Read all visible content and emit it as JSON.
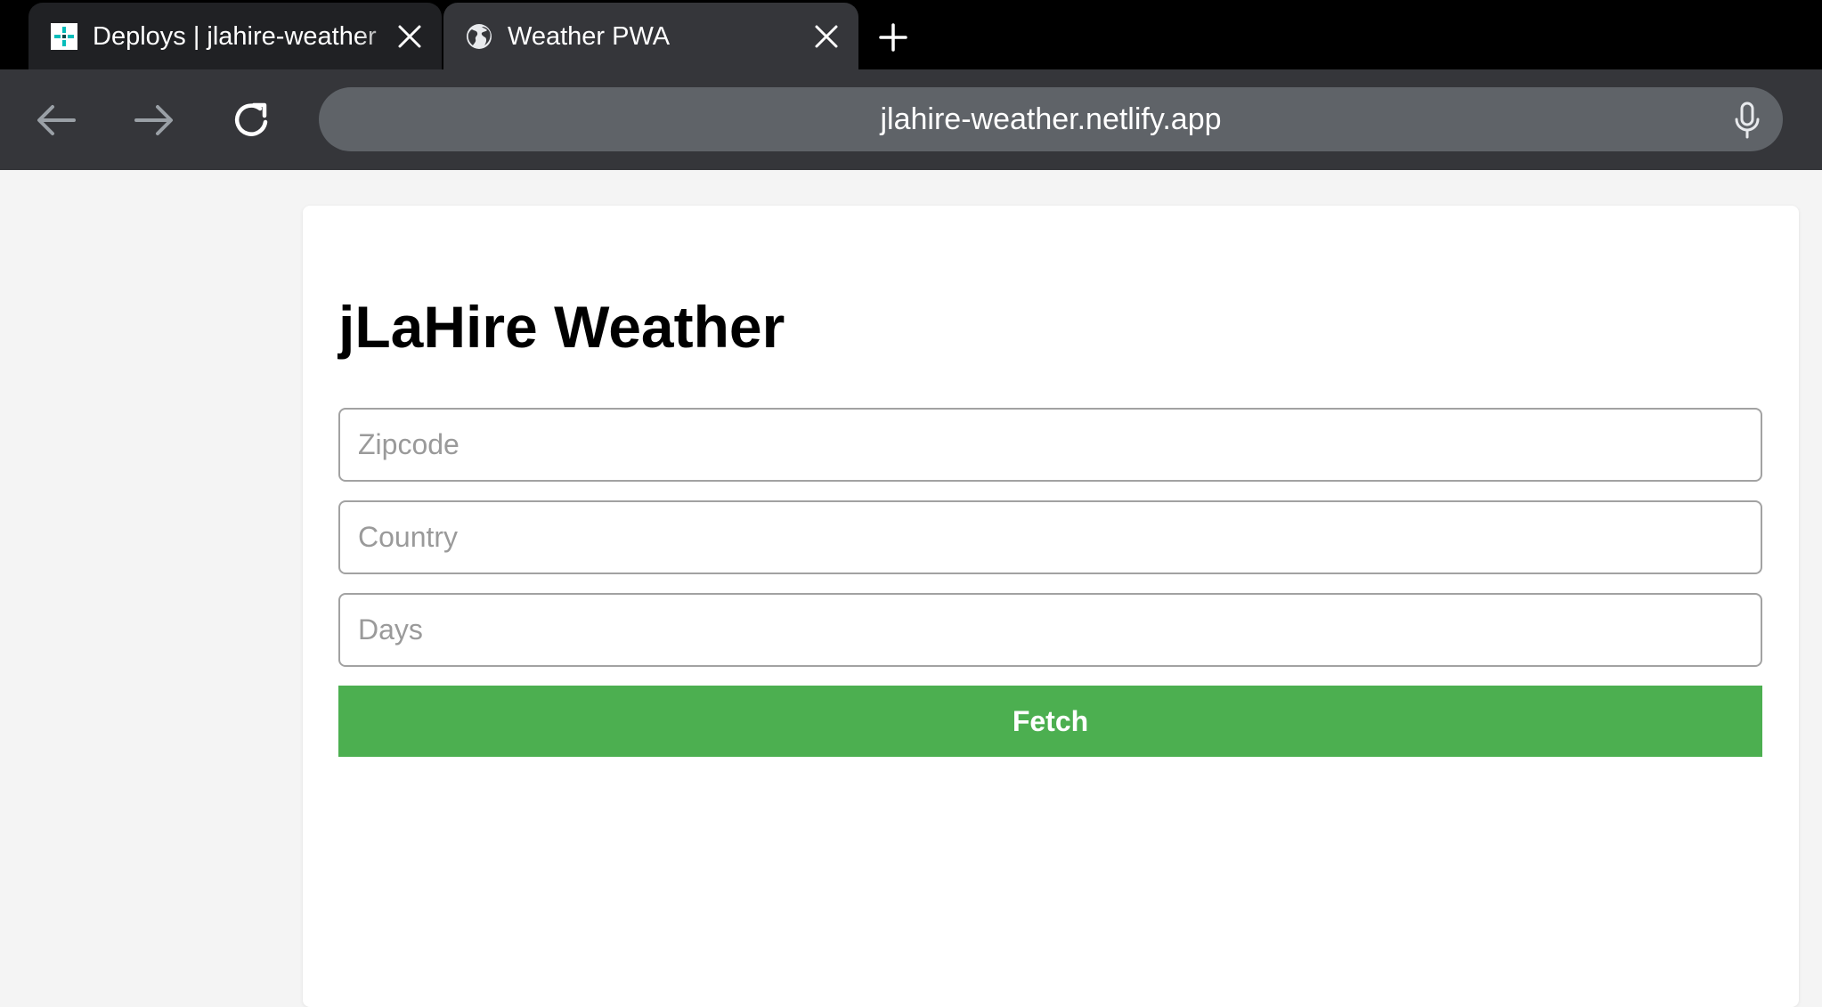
{
  "browser": {
    "tabs": [
      {
        "title": "Deploys | jlahire-weather",
        "icon": "netlify-icon",
        "close_icon": "close-icon",
        "active": false
      },
      {
        "title": "Weather PWA",
        "icon": "globe-icon",
        "close_icon": "close-icon",
        "active": true
      }
    ],
    "new_tab_icon": "plus-icon",
    "url": "jlahire-weather.netlify.app",
    "nav_icons": [
      "back-arrow-icon",
      "forward-arrow-icon",
      "reload-icon",
      "microphone-icon"
    ]
  },
  "page": {
    "title": "jLaHire Weather",
    "fields": {
      "zipcode_placeholder": "Zipcode",
      "country_placeholder": "Country",
      "days_placeholder": "Days"
    },
    "fetch_label": "Fetch"
  },
  "colors": {
    "accent_green": "#4caf50",
    "tabstrip": "#000000",
    "toolbar": "#35363a",
    "omnibox": "#5f6368"
  }
}
